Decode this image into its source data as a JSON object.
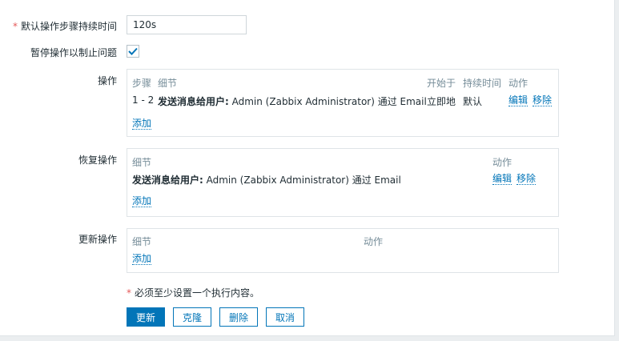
{
  "form": {
    "duration_label": "默认操作步骤持续时间",
    "duration_value": "120s",
    "pause_label": "暂停操作以制止问题",
    "pause_checked": true
  },
  "operations": {
    "label": "操作",
    "headers": {
      "steps": "步骤",
      "details": "细节",
      "start_in": "开始于",
      "duration": "持续时间",
      "action": "动作"
    },
    "rows": [
      {
        "steps": "1 - 2",
        "details_bold": "发送消息给用户:",
        "details_rest": " Admin (Zabbix Administrator) 通过 Email",
        "start_in": "立即地",
        "duration": "默认",
        "edit": "编辑",
        "remove": "移除"
      }
    ],
    "add": "添加"
  },
  "recovery": {
    "label": "恢复操作",
    "headers": {
      "details": "细节",
      "action": "动作"
    },
    "rows": [
      {
        "details_bold": "发送消息给用户:",
        "details_rest": " Admin (Zabbix Administrator) 通过 Email",
        "edit": "编辑",
        "remove": "移除"
      }
    ],
    "add": "添加"
  },
  "update": {
    "label": "更新操作",
    "headers": {
      "details": "细节",
      "action": "动作"
    },
    "add": "添加"
  },
  "footer": {
    "required_note": "必须至少设置一个执行内容。",
    "buttons": {
      "update": "更新",
      "clone": "克隆",
      "delete": "删除",
      "cancel": "取消"
    }
  },
  "colors": {
    "primary": "#0275b8",
    "required": "#e45959",
    "header_text": "#768d99"
  },
  "icons": {
    "checkbox": "checkmark-icon"
  }
}
